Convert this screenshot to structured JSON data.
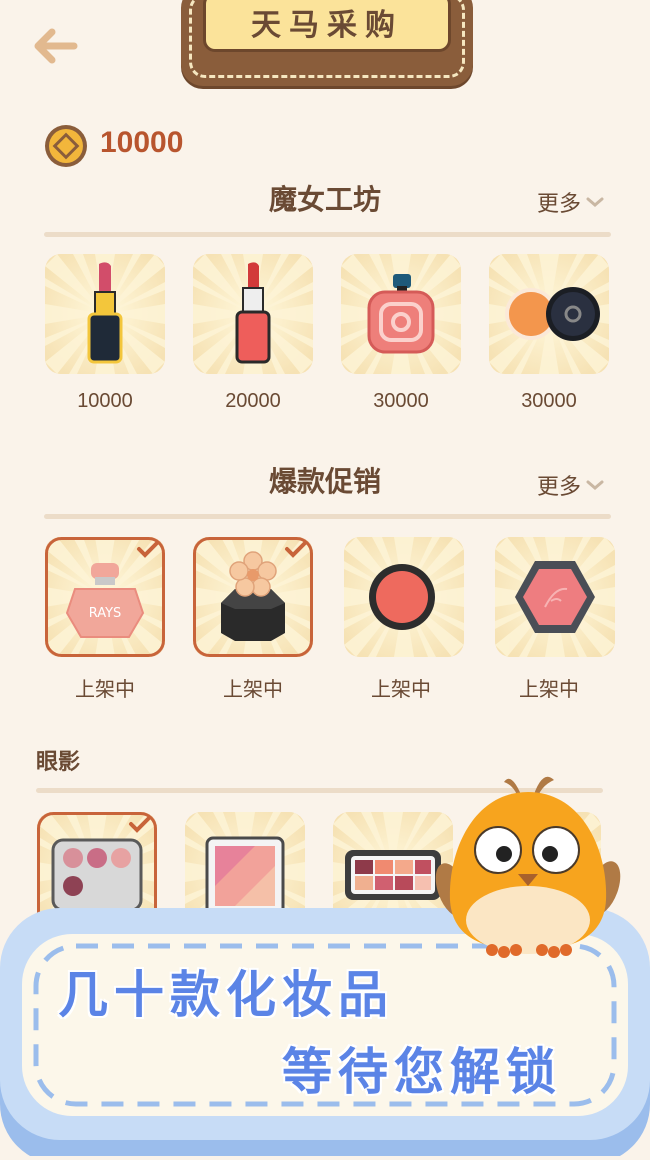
{
  "header": {
    "title": "天马采购"
  },
  "wallet": {
    "coins": "10000"
  },
  "section1": {
    "title": "魔女工坊",
    "more_label": "更多",
    "items": [
      {
        "icon": "lipstick-gold-icon",
        "price": "10000"
      },
      {
        "icon": "lipstick-red-icon",
        "price": "20000"
      },
      {
        "icon": "perfume-pink-icon",
        "price": "30000"
      },
      {
        "icon": "compact-blush-icon",
        "price": "30000"
      }
    ]
  },
  "section2": {
    "title": "爆款促销",
    "more_label": "更多",
    "items": [
      {
        "icon": "perfume-rays-icon",
        "status": "上架中",
        "selected": true,
        "label": "RAYS"
      },
      {
        "icon": "flower-box-icon",
        "status": "上架中",
        "selected": true
      },
      {
        "icon": "blush-round-icon",
        "status": "上架中",
        "selected": false
      },
      {
        "icon": "hexagon-powder-icon",
        "status": "上架中",
        "selected": false
      }
    ]
  },
  "section3": {
    "title": "眼影",
    "items": [
      {
        "icon": "eyeshadow-round-icon",
        "selected": true
      },
      {
        "icon": "eyeshadow-square-icon",
        "selected": false
      },
      {
        "icon": "eyeshadow-palette-icon",
        "selected": false
      }
    ]
  },
  "banner": {
    "line1": "几十款化妆品",
    "line2": "等待您解锁"
  },
  "colors": {
    "background": "#faf3ea",
    "accent": "#b8552e",
    "banner_text": "#5b84e6",
    "banner_bg": "#c7dcf6"
  }
}
